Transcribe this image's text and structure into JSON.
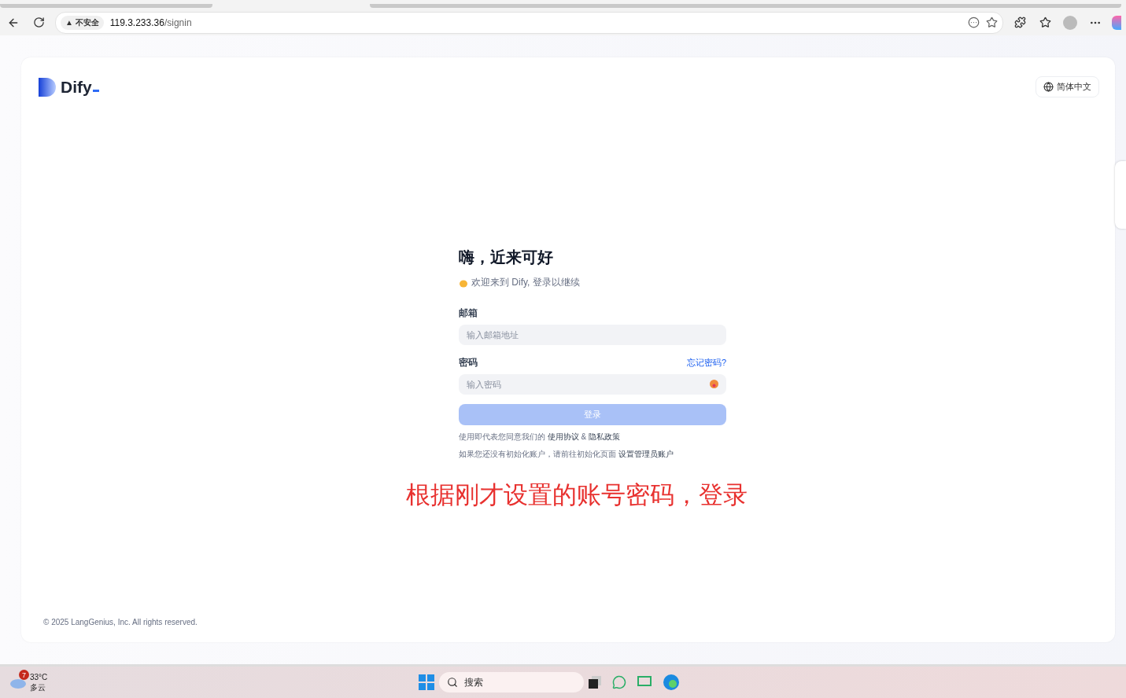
{
  "browser": {
    "security_icon": "▲",
    "security": "不安全",
    "url_host": "119.3.233.36",
    "url_path": "/signin"
  },
  "header": {
    "logo": "Dify",
    "language": "简体中文"
  },
  "form": {
    "title": "嗨，近来可好",
    "subtitle": "欢迎来到 Dify, 登录以继续",
    "fields": [
      {
        "label": "邮箱",
        "placeholder": "输入邮箱地址",
        "kind": "text"
      },
      {
        "label": "密码",
        "placeholder": "输入密码",
        "kind": "password",
        "link": "忘记密码?"
      }
    ],
    "submit": {
      "label": "登录",
      "disabled": true
    },
    "terms": {
      "text": "使用即代表您同意我们的",
      "link1": "使用协议",
      "sep": "&",
      "link2": "隐私政策"
    },
    "init": {
      "text": "如果您还没有初始化账户，请前往初始化页面",
      "link": "设置管理员账户"
    }
  },
  "annotation": "根据刚才设置的账号密码，登录",
  "footer": "© 2025 LangGenius, Inc. All rights reserved.",
  "taskbar": {
    "weather_badge": "7",
    "temperature": "33°C",
    "condition": "多云",
    "search": "搜索"
  }
}
